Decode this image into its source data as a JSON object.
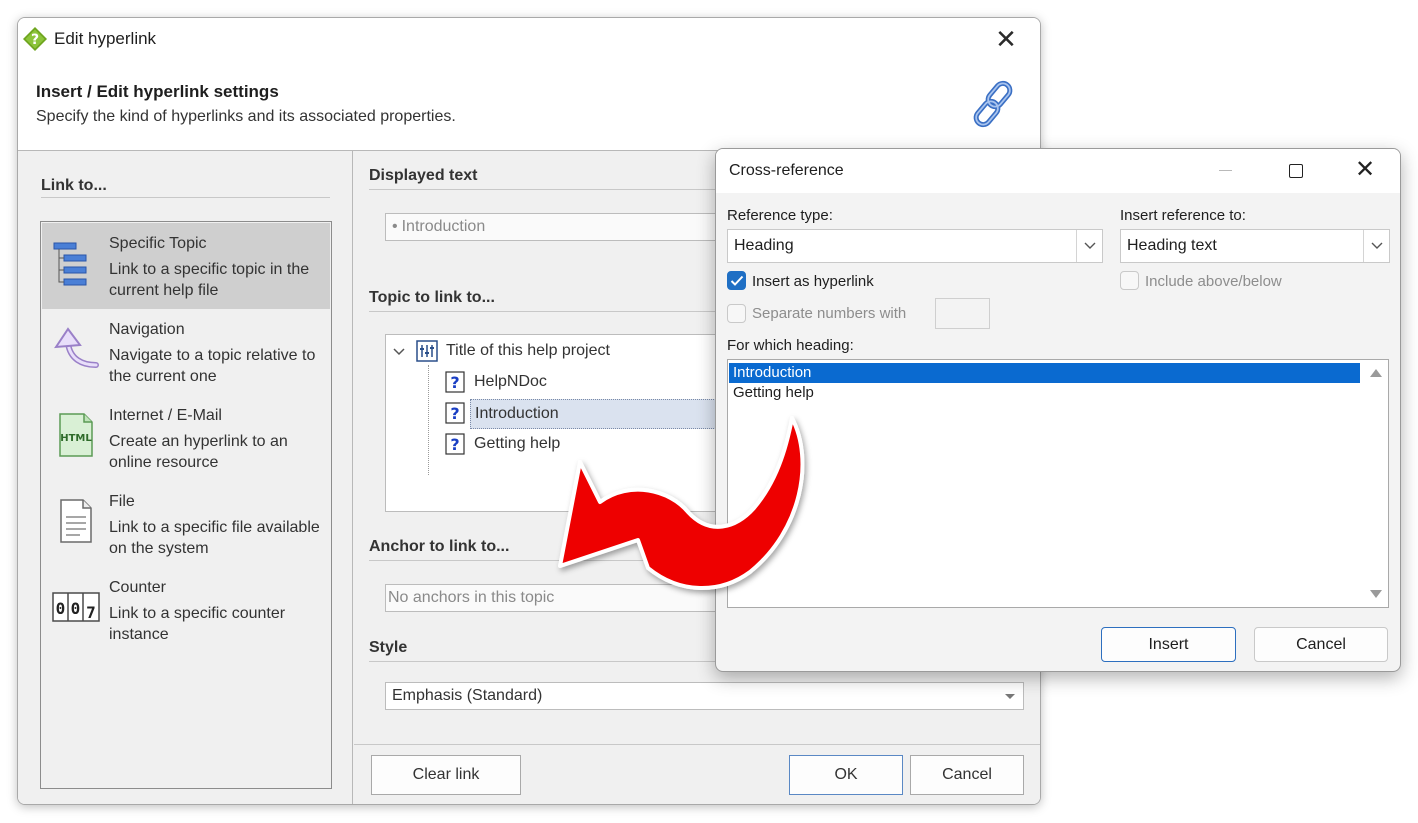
{
  "edit_dialog": {
    "title": "Edit hyperlink",
    "header_title": "Insert / Edit hyperlink settings",
    "header_subtitle": "Specify the kind of hyperlinks and its associated properties.",
    "link_to_label": "Link to...",
    "link_types": [
      {
        "title": "Specific Topic",
        "desc": "Link to a specific topic in the current help file",
        "icon": "topic-tree-icon",
        "selected": true
      },
      {
        "title": "Navigation",
        "desc": "Navigate to a topic relative to the current one",
        "icon": "navigation-arrow-icon",
        "selected": false
      },
      {
        "title": "Internet / E-Mail",
        "desc": "Create an hyperlink to an online resource",
        "icon": "html-file-icon",
        "selected": false
      },
      {
        "title": "File",
        "desc": "Link to a specific file available on the system",
        "icon": "file-icon",
        "selected": false
      },
      {
        "title": "Counter",
        "desc": "Link to a specific counter instance",
        "icon": "counter-icon",
        "selected": false
      }
    ],
    "displayed_text_label": "Displayed text",
    "displayed_text_value": "Introduction",
    "topic_label": "Topic to link to...",
    "topic_tree": {
      "root": "Title of this help project",
      "children": [
        "HelpNDoc",
        "Introduction",
        "Getting help"
      ],
      "selected": "Introduction"
    },
    "anchor_label": "Anchor to link to...",
    "anchor_value": "No anchors in this topic",
    "style_label": "Style",
    "style_value": "Emphasis (Standard)",
    "buttons": {
      "clear": "Clear link",
      "ok": "OK",
      "cancel": "Cancel"
    }
  },
  "xref_dialog": {
    "title": "Cross-reference",
    "reference_type_label": "Reference type:",
    "reference_type_value": "Heading",
    "insert_reference_label": "Insert reference to:",
    "insert_reference_value": "Heading text",
    "insert_as_hyperlink": {
      "label": "Insert as hyperlink",
      "checked": true
    },
    "include_above_below": {
      "label": "Include above/below",
      "checked": false
    },
    "separate_numbers": {
      "label": "Separate numbers with",
      "checked": false
    },
    "for_which_label": "For which heading:",
    "headings": [
      "Introduction",
      "Getting help"
    ],
    "selected_heading": "Introduction",
    "buttons": {
      "insert": "Insert",
      "cancel": "Cancel"
    }
  },
  "colors": {
    "selection_blue": "#0a6ad0",
    "checkbox_blue": "#1f6fc4",
    "arrow_red": "#ee0000",
    "tree_selection": "#dae2ef"
  }
}
